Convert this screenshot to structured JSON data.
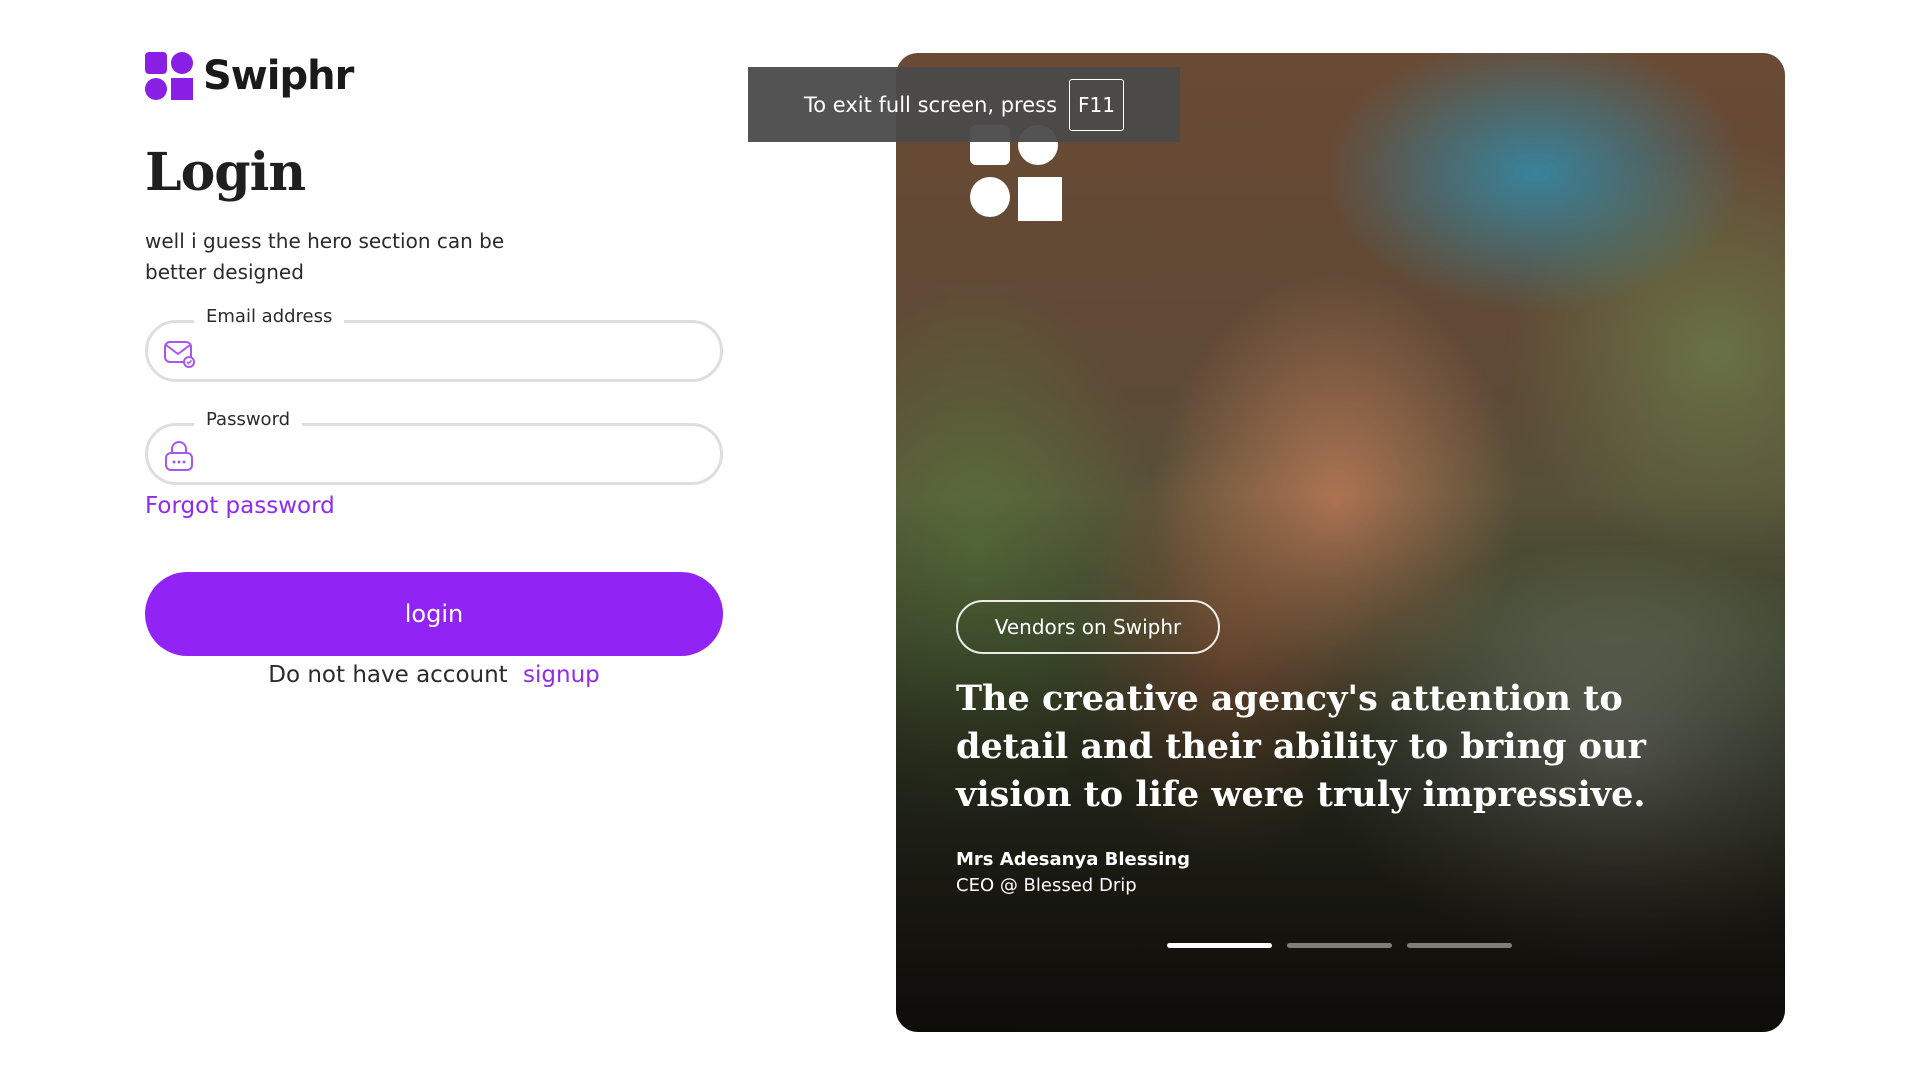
{
  "brand": {
    "name": "Swiphr",
    "accent_color": "#9223f5",
    "logo_icon": "swiphr-logo-icon"
  },
  "login": {
    "title": "Login",
    "subtitle": "well i guess the hero section can be better designed",
    "email": {
      "label": "Email address",
      "value": "",
      "icon": "mail-check-icon"
    },
    "password": {
      "label": "Password",
      "value": "",
      "icon": "lock-icon"
    },
    "forgot_label": "Forgot password",
    "button_label": "login",
    "no_account_text": "Do not have account",
    "signup_label": "signup"
  },
  "hero": {
    "badge": "Vendors on Swiphr",
    "quote": "The creative agency's attention to detail and their ability to bring our vision to life were truly impressive.",
    "author_name": "Mrs Adesanya Blessing",
    "author_role": "CEO @ Blessed Drip",
    "slides_count": 3,
    "active_slide": 1
  },
  "fullscreen_notice": {
    "text": "To exit full screen, press",
    "key": "F11"
  }
}
